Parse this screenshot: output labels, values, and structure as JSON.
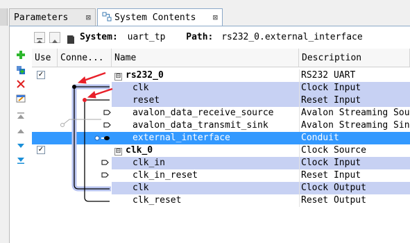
{
  "tabs": [
    {
      "label": "Parameters",
      "close": "⊠"
    },
    {
      "label": "System Contents",
      "close": "⊠"
    }
  ],
  "pathbar": {
    "system_label": "System:",
    "system_value": "uart_tp",
    "path_label": "Path:",
    "path_value": "rs232_0.external_interface"
  },
  "table": {
    "headers": {
      "use": "Use",
      "connections": "Conne...",
      "name": "Name",
      "description": "Description"
    },
    "rows": [
      {
        "expander": "⊟",
        "name": "rs232_0",
        "desc": "RS232 UART",
        "checked": "✓"
      },
      {
        "name": "clk",
        "desc": "Clock Input"
      },
      {
        "name": "reset",
        "desc": "Reset Input"
      },
      {
        "name": "avalon_data_receive_source",
        "desc": "Avalon Streaming Sou"
      },
      {
        "name": "avalon_data_transmit_sink",
        "desc": "Avalon Streaming Sin"
      },
      {
        "name": "external_interface",
        "desc": "Conduit"
      },
      {
        "expander": "⊟",
        "name": "clk_0",
        "desc": "Clock Source",
        "checked": "✓"
      },
      {
        "name": "clk_in",
        "desc": "Clock Input"
      },
      {
        "name": "clk_in_reset",
        "desc": "Reset Input"
      },
      {
        "name": "clk",
        "desc": "Clock Output"
      },
      {
        "name": "clk_reset",
        "desc": "Reset Output"
      }
    ]
  },
  "colors": {
    "accent": "#3399ff",
    "highlight": "#c7d1f3",
    "arrow": "#e8202a",
    "conn_line": "#000000",
    "add": "#2eb82e",
    "remove": "#e02020",
    "move": "#1a8fd8"
  },
  "side_tools": [
    "add-icon",
    "add-component-icon",
    "remove-icon",
    "edit-icon",
    "move-top-icon",
    "move-up-icon",
    "move-down-icon",
    "move-bottom-icon"
  ]
}
